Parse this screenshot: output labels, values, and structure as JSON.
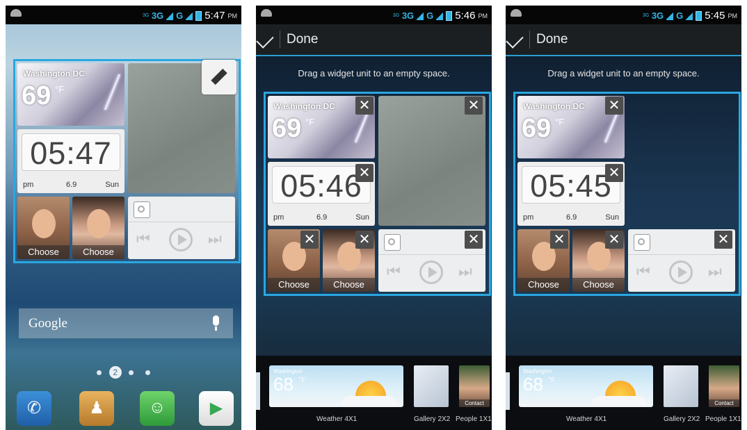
{
  "statusbar": {
    "net_small": "3G",
    "net_main": "3G",
    "net_second": "G",
    "screens": [
      {
        "time": "5:47",
        "ampm": "PM"
      },
      {
        "time": "5:46",
        "ampm": "PM"
      },
      {
        "time": "5:45",
        "ampm": "PM"
      }
    ]
  },
  "edit_bar": {
    "done_label": "Done",
    "hint": "Drag a widget unit to an empty space."
  },
  "weather_widget": {
    "city": "Washington DC",
    "temp": "69",
    "unit": "°F"
  },
  "clock_widgets": [
    {
      "time": "05:47",
      "ampm": "pm",
      "date": "6.9",
      "day": "Sun"
    },
    {
      "time": "05:46",
      "ampm": "pm",
      "date": "6.9",
      "day": "Sun"
    },
    {
      "time": "05:45",
      "ampm": "pm",
      "date": "6.9",
      "day": "Sun"
    }
  ],
  "people_widget": {
    "choose_label": "Choose"
  },
  "close_glyph": "✕",
  "search_bar": {
    "label": "Google"
  },
  "page_indicator": {
    "current": "2"
  },
  "dock": {
    "icons": [
      "phone-icon",
      "contacts-icon",
      "messaging-icon",
      "play-store-icon"
    ]
  },
  "widget_tray": {
    "weather": {
      "city": "Washington",
      "temp": "68",
      "unit": "°F",
      "label": "Weather 4X1"
    },
    "gallery": {
      "label": "Gallery 2X2"
    },
    "people": {
      "badge": "Contact",
      "label": "People 1X1"
    }
  },
  "colors": {
    "accent": "#2aa7e0",
    "status_blue": "#33b5e5"
  }
}
